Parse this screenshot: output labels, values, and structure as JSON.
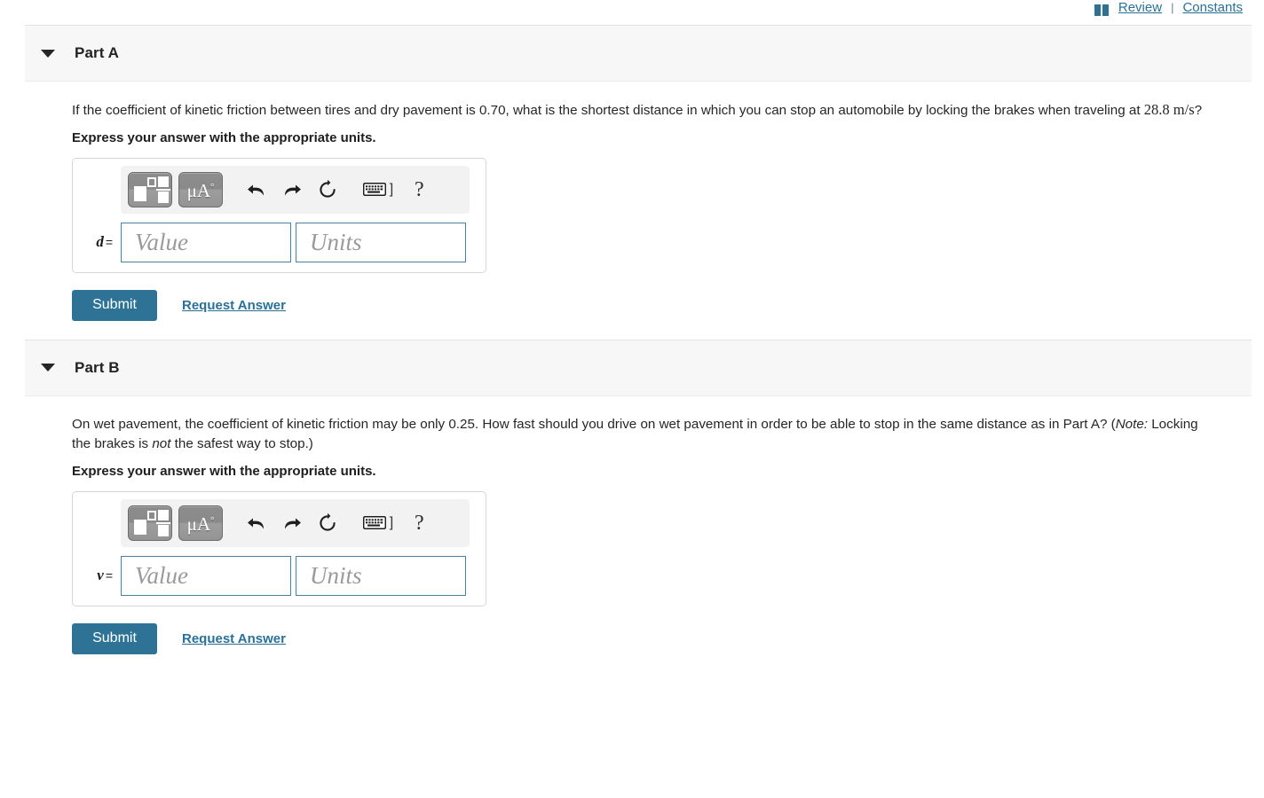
{
  "header": {
    "book_icon": "open-book-icon",
    "review_label": "Review",
    "separator": "|",
    "constants_label": "Constants"
  },
  "toolbar": {
    "template_button": "math-template-button",
    "units_button_label": "μÅ",
    "units_button_sup": "°",
    "undo_icon": "undo-arrow-icon",
    "redo_icon": "redo-arrow-icon",
    "reset_icon": "reset-circular-arrow-icon",
    "keyboard_icon": "keyboard-icon",
    "keyboard_bracket": "]",
    "help_label": "?"
  },
  "fields": {
    "value_placeholder": "Value",
    "units_placeholder": "Units"
  },
  "actions": {
    "submit_label": "Submit",
    "request_answer_label": "Request Answer"
  },
  "colors": {
    "accent": "#2e7395",
    "link": "#2b7096",
    "field_border": "#4c7f99",
    "part_header_bg": "#f7f7f7"
  },
  "parts": [
    {
      "id": "part-a",
      "title": "Part A",
      "question_lead": "If the coefficient of kinetic friction between tires and dry pavement is 0.70, what is the shortest distance in which you can stop an automobile by locking the brakes when traveling at ",
      "question_math_value": "28.8",
      "question_math_units_num": "m",
      "question_math_units_den": "s",
      "question_tail": "?",
      "instruction": "Express your answer with the appropriate units.",
      "variable": "d",
      "equals": "="
    },
    {
      "id": "part-b",
      "title": "Part B",
      "question_lead": "On wet pavement, the coefficient of kinetic friction may be only 0.25. How fast should you drive on wet pavement in order to be able to stop in the same distance as in Part A? (",
      "note_italic": "Note:",
      "question_mid": " Locking the brakes is ",
      "not_italic": "not",
      "question_tail": " the safest way to stop.)",
      "instruction": "Express your answer with the appropriate units.",
      "variable": "v",
      "equals": "="
    }
  ]
}
